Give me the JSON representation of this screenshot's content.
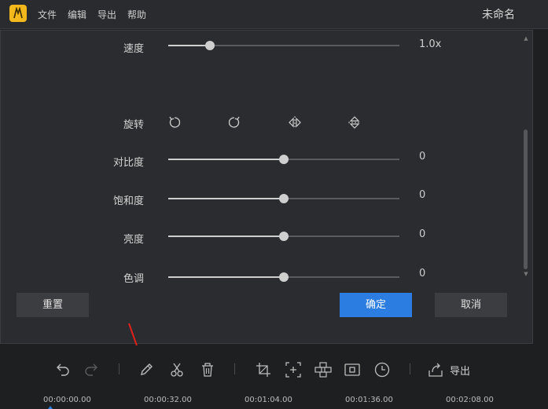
{
  "window": {
    "title": "未命名",
    "menu": [
      "文件",
      "编辑",
      "导出",
      "帮助"
    ]
  },
  "panel": {
    "speed": {
      "label": "速度",
      "value_text": "1.0x",
      "level": 0.18
    },
    "rotate": {
      "label": "旋转",
      "icons": [
        "rotate-left-icon",
        "rotate-right-icon",
        "flip-horizontal-icon",
        "flip-vertical-icon"
      ]
    },
    "contrast": {
      "label": "对比度",
      "value_text": "0",
      "level": 0.5
    },
    "saturation": {
      "label": "饱和度",
      "value_text": "0",
      "level": 0.5
    },
    "brightness": {
      "label": "亮度",
      "value_text": "0",
      "level": 0.5
    },
    "hue": {
      "label": "色调",
      "value_text": "0",
      "level": 0.5
    },
    "buttons": {
      "reset": "重置",
      "confirm": "确定",
      "cancel": "取消"
    }
  },
  "toolbar": {
    "icons": [
      "undo-icon",
      "redo-icon",
      "edit-icon",
      "cut-icon",
      "delete-icon",
      "crop-icon",
      "zoom-icon",
      "mosaic-icon",
      "screenshot-icon",
      "clock-icon",
      "export-icon"
    ],
    "export_label": "导出"
  },
  "timeline": {
    "ticks": [
      "00:00:00.00",
      "00:00:32.00",
      "00:01:04.00",
      "00:01:36.00",
      "00:02:08.00"
    ]
  },
  "colors": {
    "accent": "#2b7de1",
    "logo": "#f3b91c",
    "annotation_arrow": "#e0201c"
  }
}
